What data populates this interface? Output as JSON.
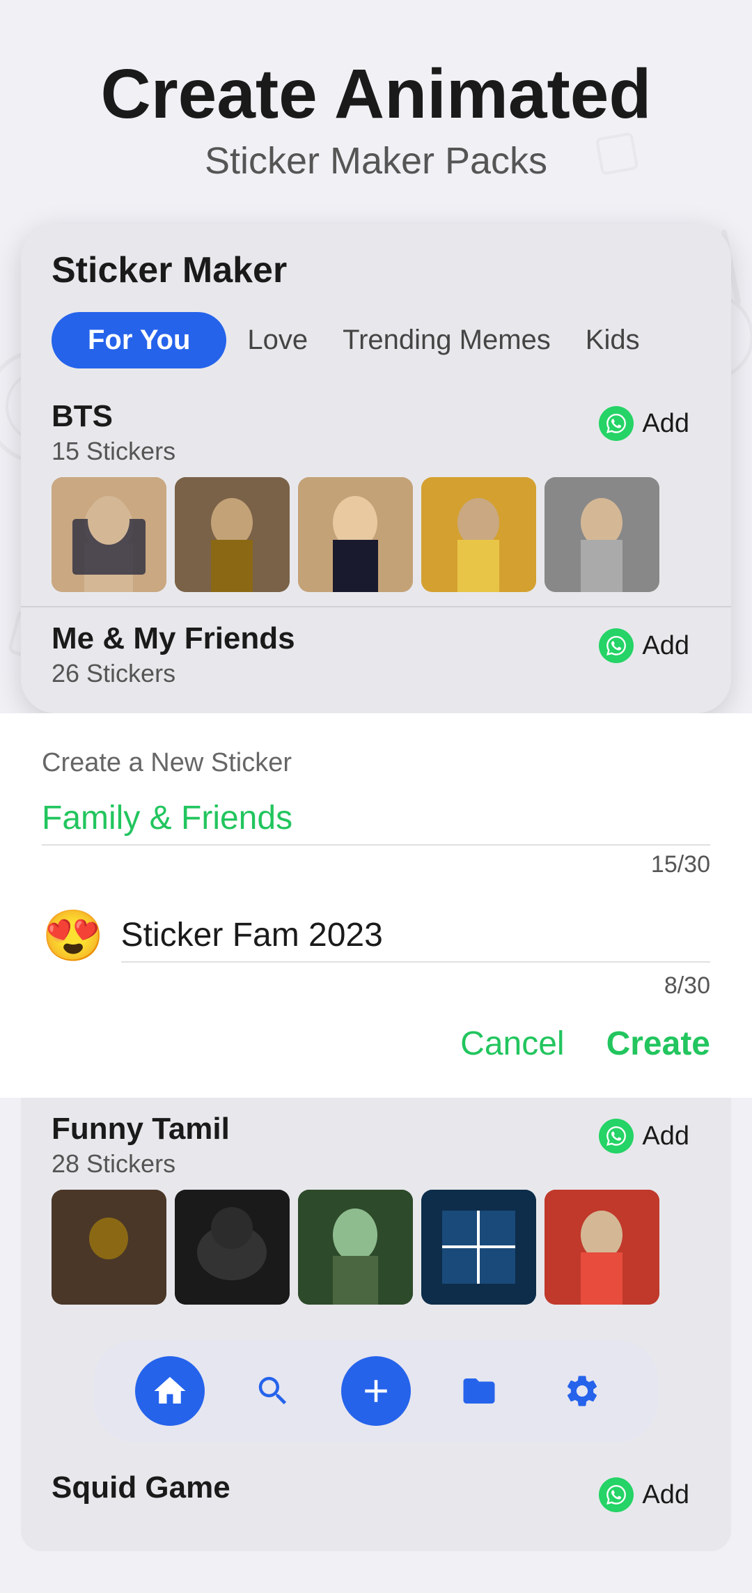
{
  "header": {
    "title_line1": "Create Animated",
    "title_line2": "Sticker Maker Packs"
  },
  "phone_card": {
    "title": "Sticker Maker",
    "tabs": [
      {
        "label": "For You",
        "active": true
      },
      {
        "label": "Love",
        "active": false
      },
      {
        "label": "Trending Memes",
        "active": false
      },
      {
        "label": "Kids",
        "active": false
      }
    ]
  },
  "packs": [
    {
      "name": "BTS",
      "count": "15 Stickers",
      "add_label": "Add"
    },
    {
      "name": "Me & My Friends",
      "count": "26 Stickers",
      "add_label": "Add"
    },
    {
      "name": "Funny Tamil",
      "count": "28 Stickers",
      "add_label": "Add"
    },
    {
      "name": "Squid Game",
      "count": "",
      "add_label": "Add"
    }
  ],
  "create_panel": {
    "label": "Create a New Sticker",
    "field1": {
      "value": "Family & Friends",
      "char_count": "15/30"
    },
    "field2": {
      "emoji": "😍",
      "value": "Sticker Fam 2023",
      "char_count": "8/30"
    },
    "cancel_label": "Cancel",
    "create_label": "Create"
  },
  "bottom_nav": {
    "items": [
      {
        "label": "home",
        "icon": "home-icon",
        "active": true
      },
      {
        "label": "search",
        "icon": "search-icon",
        "active": false
      },
      {
        "label": "add",
        "icon": "add-icon",
        "active": false
      },
      {
        "label": "folder",
        "icon": "folder-icon",
        "active": false
      },
      {
        "label": "settings",
        "icon": "settings-icon",
        "active": false
      }
    ]
  }
}
